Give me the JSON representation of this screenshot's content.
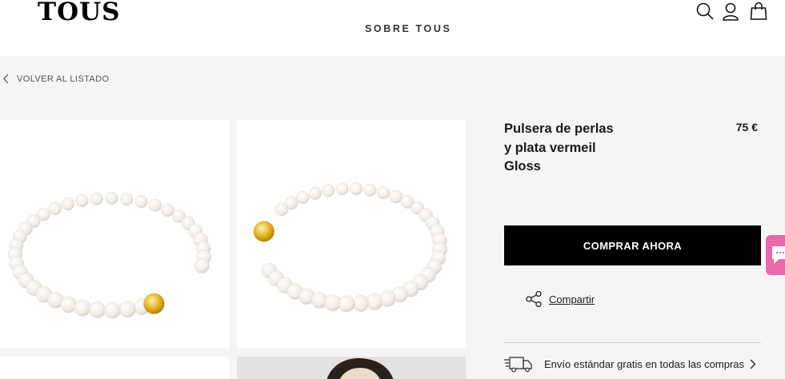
{
  "header": {
    "logo": "TOUS",
    "nav": {
      "about_label": "SOBRE TOUS"
    },
    "icons": [
      "search-icon",
      "user-icon",
      "bag-icon"
    ]
  },
  "back_link": {
    "label": "VOLVER AL LISTADO"
  },
  "product": {
    "title_lines": [
      "Pulsera de perlas",
      "y plata vermeil",
      "Gloss"
    ],
    "price": "75 €",
    "buy_label": "COMPRAR AHORA",
    "share_label": "Compartir",
    "shipping_label": "Envío estándar gratis en todas las compras"
  },
  "colors": {
    "content_background": "#f5f5f5",
    "buy_button": "#000000",
    "chat_tab": "#e86aa8",
    "gold": "#e3b320"
  }
}
